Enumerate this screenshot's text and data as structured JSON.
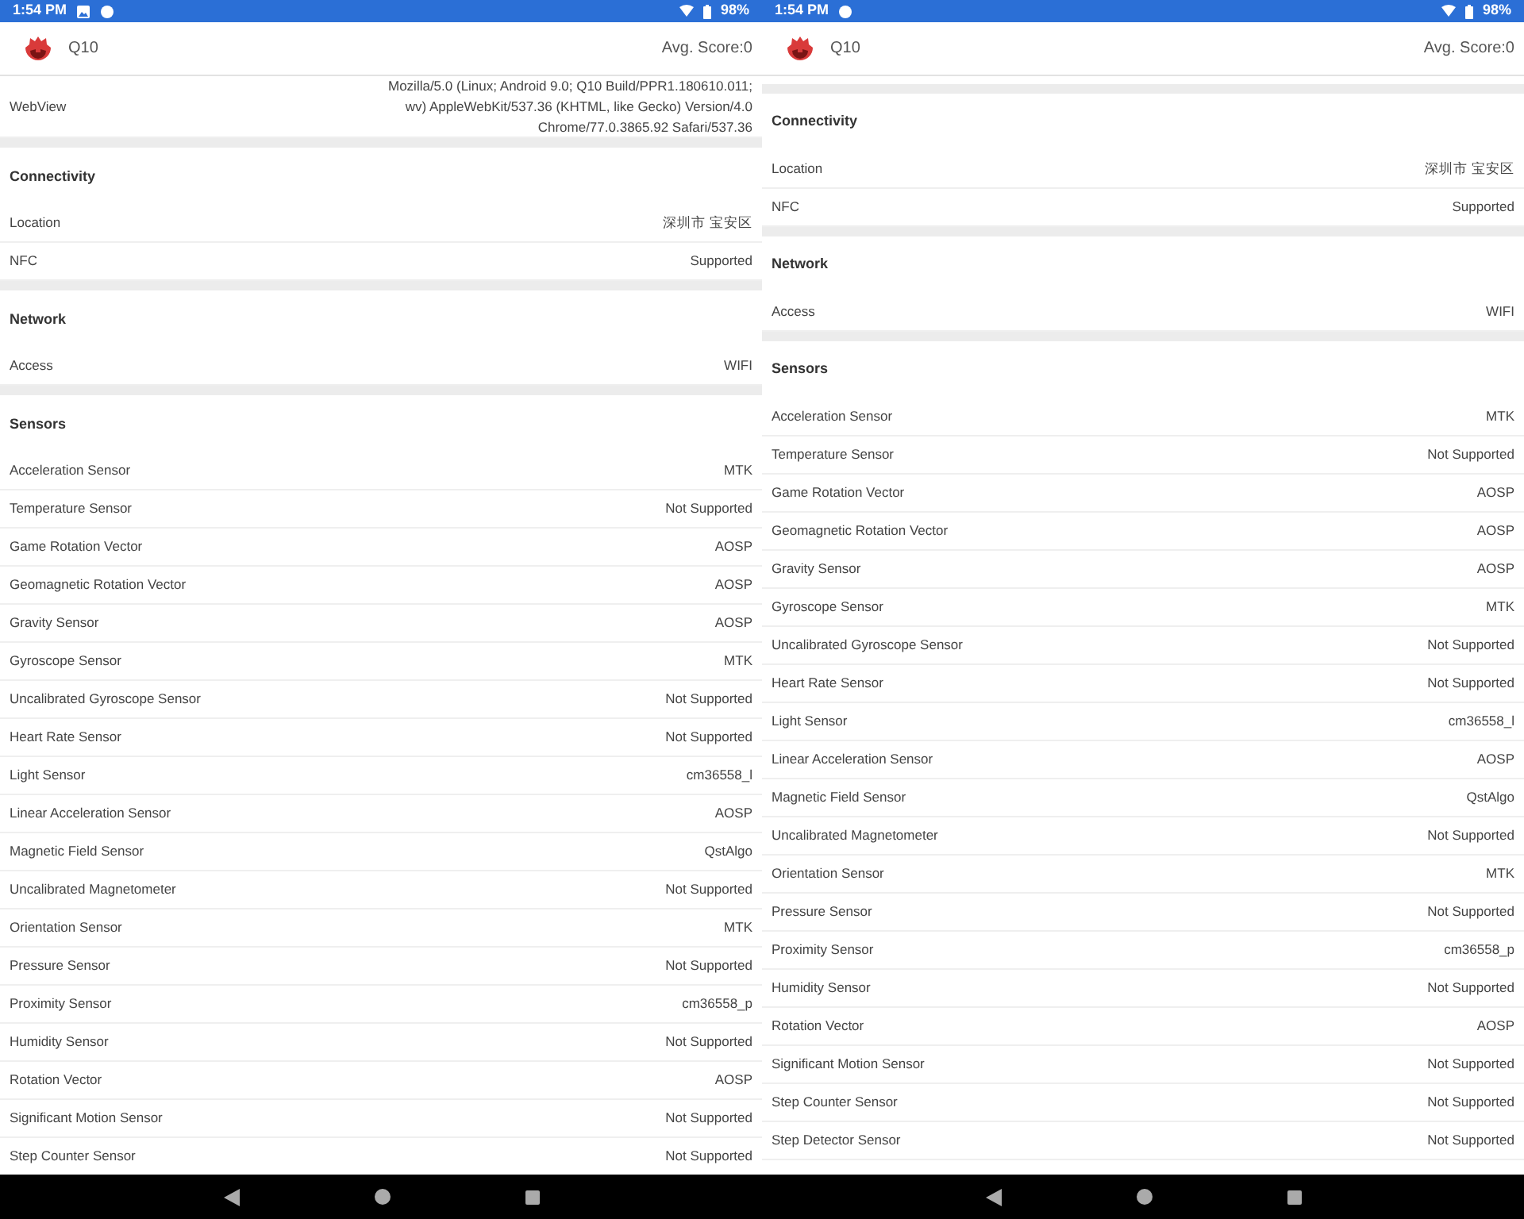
{
  "screens": [
    {
      "status_bar": {
        "time": "1:54 PM",
        "notifications": [
          {
            "kind": "image"
          },
          {
            "kind": "circle"
          }
        ],
        "battery": "98%"
      },
      "header": {
        "device": "Q10",
        "score": "Avg. Score:0"
      },
      "scrolled": false,
      "sections": [
        {
          "rows": [
            {
              "label": "WebView",
              "value": "Mozilla/5.0 (Linux; Android 9.0; Q10 Build/PPR1.180610.011; wv) AppleWebKit/537.36 (KHTML, like Gecko) Version/4.0 Chrome/77.0.3865.92 Safari/537.36"
            }
          ]
        },
        {
          "title": "Connectivity",
          "rows": [
            {
              "label": "Location",
              "value": "深圳市 宝安区"
            },
            {
              "label": "NFC",
              "value": "Supported"
            }
          ]
        },
        {
          "title": "Network",
          "rows": [
            {
              "label": "Access",
              "value": "WIFI"
            }
          ]
        },
        {
          "title": "Sensors",
          "rows": [
            {
              "label": "Acceleration Sensor",
              "value": "MTK"
            },
            {
              "label": "Temperature Sensor",
              "value": "Not Supported"
            },
            {
              "label": "Game Rotation Vector",
              "value": "AOSP"
            },
            {
              "label": "Geomagnetic Rotation Vector",
              "value": "AOSP"
            },
            {
              "label": "Gravity Sensor",
              "value": "AOSP"
            },
            {
              "label": "Gyroscope Sensor",
              "value": "MTK"
            },
            {
              "label": "Uncalibrated Gyroscope Sensor",
              "value": "Not Supported"
            },
            {
              "label": "Heart Rate Sensor",
              "value": "Not Supported"
            },
            {
              "label": "Light Sensor",
              "value": "cm36558_l"
            },
            {
              "label": "Linear Acceleration Sensor",
              "value": "AOSP"
            },
            {
              "label": "Magnetic Field Sensor",
              "value": "QstAlgo"
            },
            {
              "label": "Uncalibrated Magnetometer",
              "value": "Not Supported"
            },
            {
              "label": "Orientation Sensor",
              "value": "MTK"
            },
            {
              "label": "Pressure Sensor",
              "value": "Not Supported"
            },
            {
              "label": "Proximity Sensor",
              "value": "cm36558_p"
            },
            {
              "label": "Humidity Sensor",
              "value": "Not Supported"
            },
            {
              "label": "Rotation Vector",
              "value": "AOSP"
            },
            {
              "label": "Significant Motion Sensor",
              "value": "Not Supported"
            },
            {
              "label": "Step Counter Sensor",
              "value": "Not Supported"
            }
          ]
        }
      ]
    },
    {
      "status_bar": {
        "time": "1:54 PM",
        "notifications": [
          {
            "kind": "circle"
          }
        ],
        "battery": "98%"
      },
      "header": {
        "device": "Q10",
        "score": "Avg. Score:0"
      },
      "scrolled": true,
      "sections": [
        {
          "title": "Connectivity",
          "rows": [
            {
              "label": "Location",
              "value": "深圳市 宝安区"
            },
            {
              "label": "NFC",
              "value": "Supported"
            }
          ]
        },
        {
          "title": "Network",
          "rows": [
            {
              "label": "Access",
              "value": "WIFI"
            }
          ]
        },
        {
          "title": "Sensors",
          "rows": [
            {
              "label": "Acceleration Sensor",
              "value": "MTK"
            },
            {
              "label": "Temperature Sensor",
              "value": "Not Supported"
            },
            {
              "label": "Game Rotation Vector",
              "value": "AOSP"
            },
            {
              "label": "Geomagnetic Rotation Vector",
              "value": "AOSP"
            },
            {
              "label": "Gravity Sensor",
              "value": "AOSP"
            },
            {
              "label": "Gyroscope Sensor",
              "value": "MTK"
            },
            {
              "label": "Uncalibrated Gyroscope Sensor",
              "value": "Not Supported"
            },
            {
              "label": "Heart Rate Sensor",
              "value": "Not Supported"
            },
            {
              "label": "Light Sensor",
              "value": "cm36558_l"
            },
            {
              "label": "Linear Acceleration Sensor",
              "value": "AOSP"
            },
            {
              "label": "Magnetic Field Sensor",
              "value": "QstAlgo"
            },
            {
              "label": "Uncalibrated Magnetometer",
              "value": "Not Supported"
            },
            {
              "label": "Orientation Sensor",
              "value": "MTK"
            },
            {
              "label": "Pressure Sensor",
              "value": "Not Supported"
            },
            {
              "label": "Proximity Sensor",
              "value": "cm36558_p"
            },
            {
              "label": "Humidity Sensor",
              "value": "Not Supported"
            },
            {
              "label": "Rotation Vector",
              "value": "AOSP"
            },
            {
              "label": "Significant Motion Sensor",
              "value": "Not Supported"
            },
            {
              "label": "Step Counter Sensor",
              "value": "Not Supported"
            },
            {
              "label": "Step Detector Sensor",
              "value": "Not Supported"
            }
          ]
        }
      ]
    }
  ]
}
